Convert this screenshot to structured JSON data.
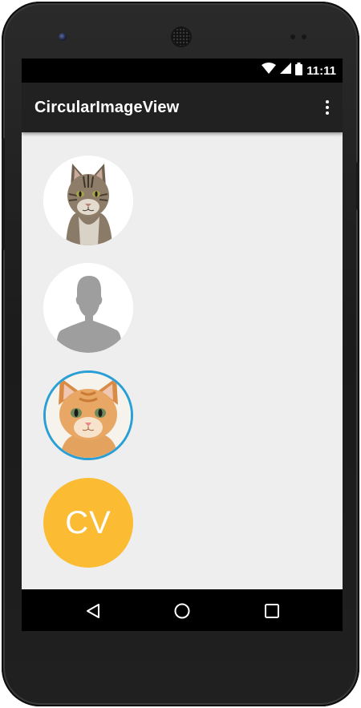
{
  "status_bar": {
    "time": "11:11",
    "icons": [
      "wifi-icon",
      "cell-signal-icon",
      "battery-icon"
    ]
  },
  "app_bar": {
    "title": "CircularImageView",
    "overflow_icon": "more-vert-icon"
  },
  "avatars": [
    {
      "type": "image",
      "subject": "tabby cat",
      "border": false
    },
    {
      "type": "image",
      "subject": "default person silhouette",
      "border": false
    },
    {
      "type": "image",
      "subject": "orange kitten",
      "border": true,
      "border_color": "#2a9fd6"
    },
    {
      "type": "initials",
      "text": "CV",
      "background": "#fbbb33",
      "text_color": "#ffffff"
    }
  ],
  "nav_bar": {
    "buttons": [
      "back-icon",
      "home-icon",
      "recents-icon"
    ]
  },
  "colors": {
    "content_background": "#eeeeee",
    "app_bar": "#212121",
    "accent_border": "#2a9fd6",
    "initials_background": "#fbbb33"
  }
}
